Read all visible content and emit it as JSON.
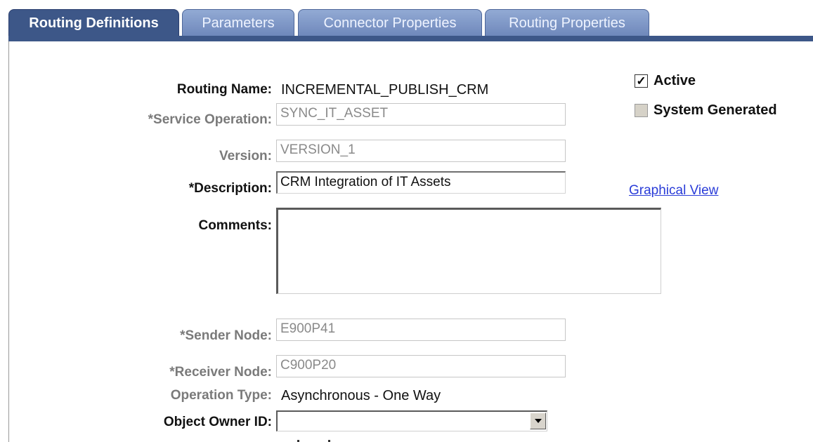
{
  "tabs": [
    {
      "label": "Routing Definitions",
      "active": true
    },
    {
      "label": "Parameters",
      "active": false
    },
    {
      "label": "Connector Properties",
      "active": false
    },
    {
      "label": "Routing Properties",
      "active": false
    }
  ],
  "form": {
    "routing_name_label": "Routing Name:",
    "routing_name_value": "INCREMENTAL_PUBLISH_CRM",
    "service_operation_label": "*Service Operation:",
    "service_operation_value": "SYNC_IT_ASSET",
    "version_label": "Version:",
    "version_value": "VERSION_1",
    "description_label": "*Description:",
    "description_value": "CRM Integration of IT Assets",
    "comments_label": "Comments:",
    "comments_value": "",
    "sender_node_label": "*Sender Node:",
    "sender_node_value": "E900P41",
    "receiver_node_label": "*Receiver Node:",
    "receiver_node_value": "C900P20",
    "operation_type_label": "Operation Type:",
    "operation_type_value": "Asynchronous - One Way",
    "object_owner_label": "Object Owner ID:",
    "object_owner_value": ""
  },
  "checkboxes": {
    "active_label": "Active",
    "active_checked": true,
    "system_generated_label": "System Generated",
    "system_generated_checked": false
  },
  "links": {
    "graphical_view": "Graphical View"
  },
  "colors": {
    "tab_active": "#3d5788",
    "tab_inactive": "#7f97c8",
    "link": "#2a3cd8",
    "disabled_text": "#7a7a7a"
  }
}
